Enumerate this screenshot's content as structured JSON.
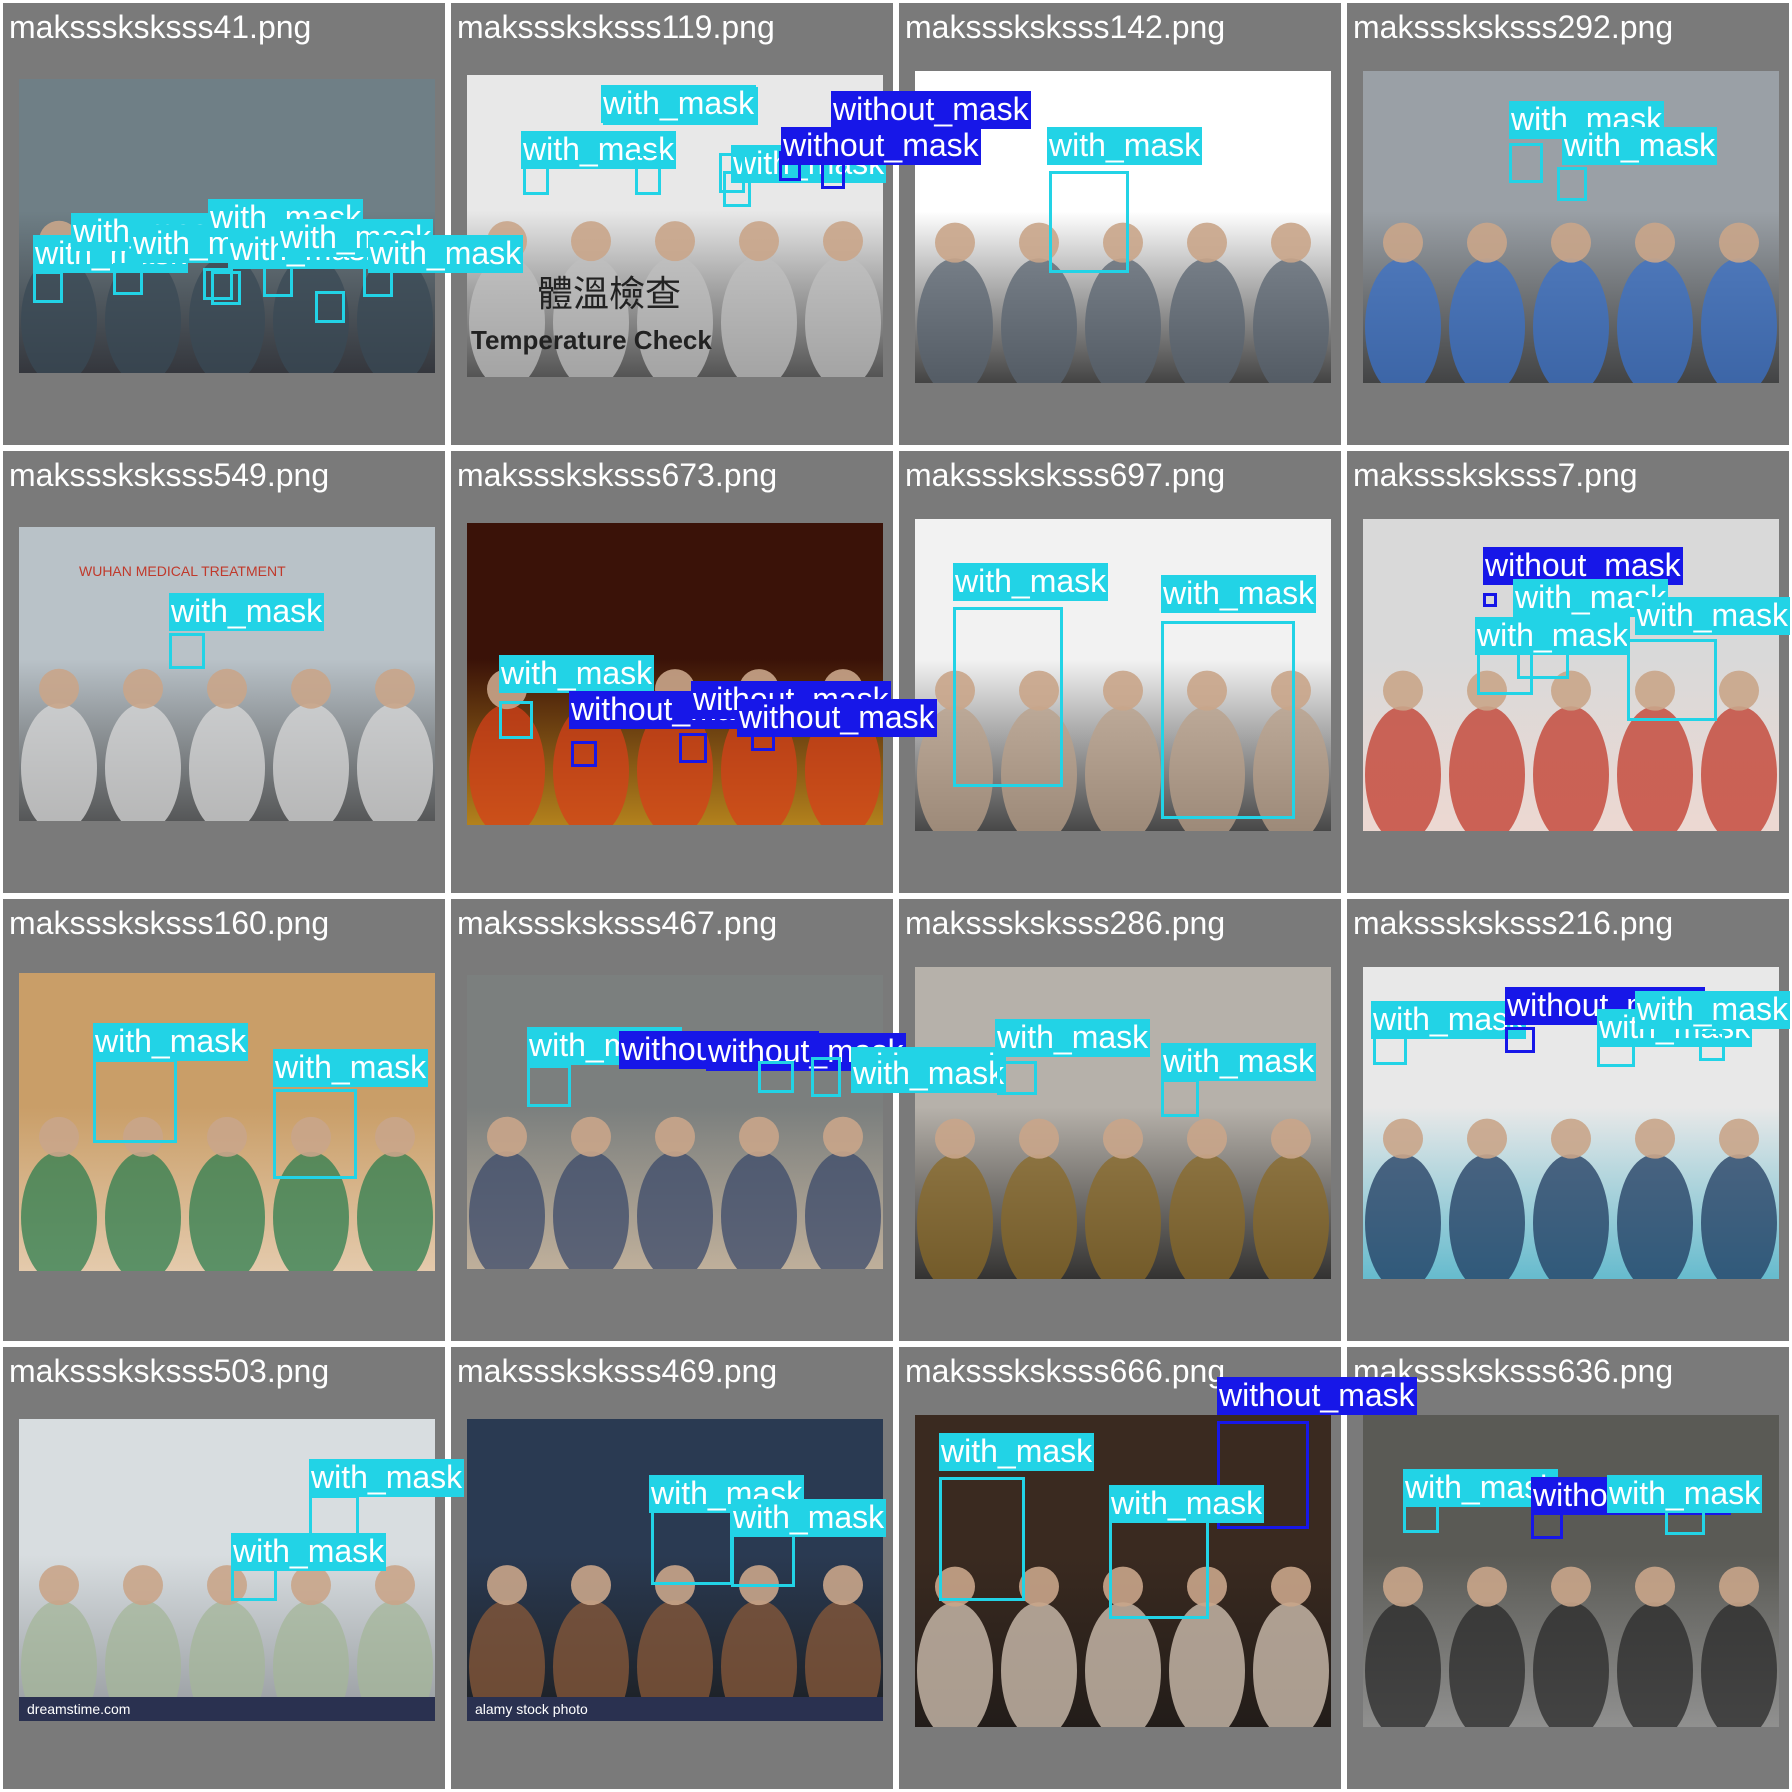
{
  "colors": {
    "tile_bg": "#7a7a7a",
    "with_mask": "#22d3e6",
    "without_mask": "#1717e8",
    "label_text": "#ffffff"
  },
  "tiles": [
    {
      "filename": "maksssksksss41.png",
      "scene": "building",
      "detections": [
        {
          "label": "with_mask"
        },
        {
          "label": "with_mask"
        },
        {
          "label": "with_mask"
        },
        {
          "label": "with_mask"
        },
        {
          "label": "with_mask"
        },
        {
          "label": "with_mask"
        },
        {
          "label": "with_mask"
        }
      ]
    },
    {
      "filename": "maksssksksss119.png",
      "scene": "temperature",
      "caption_cn": "體溫檢查",
      "caption_en": "Temperature Check",
      "detections": [
        {
          "label": "with_mask"
        },
        {
          "label": "with_mask"
        },
        {
          "label": "with_mask"
        },
        {
          "label": "with_mask"
        },
        {
          "label": "without_mask"
        },
        {
          "label": "without_mask"
        }
      ]
    },
    {
      "filename": "maksssksksss142.png",
      "scene": "businessman",
      "detections": [
        {
          "label": "with_mask"
        }
      ]
    },
    {
      "filename": "maksssksksss292.png",
      "scene": "street_emoji",
      "detections": [
        {
          "label": "with_mask"
        },
        {
          "label": "with_mask"
        }
      ]
    },
    {
      "filename": "maksssksksss549.png",
      "scene": "hospital",
      "sign_text": "WUHAN MEDICAL TREATMENT",
      "detections": [
        {
          "label": "with_mask"
        }
      ]
    },
    {
      "filename": "maksssksksss673.png",
      "scene": "market",
      "detections": [
        {
          "label": "with_mask"
        },
        {
          "label": "without_mask"
        },
        {
          "label": "without_mask"
        },
        {
          "label": "without_mask"
        }
      ]
    },
    {
      "filename": "maksssksksss697.png",
      "scene": "selfies",
      "detections": [
        {
          "label": "with_mask"
        },
        {
          "label": "with_mask"
        }
      ]
    },
    {
      "filename": "maksssksksss7.png",
      "scene": "train",
      "detections": [
        {
          "label": "without_mask"
        },
        {
          "label": "with_mask"
        },
        {
          "label": "with_mask"
        },
        {
          "label": "with_mask"
        }
      ]
    },
    {
      "filename": "maksssksksss160.png",
      "scene": "kids",
      "detections": [
        {
          "label": "with_mask"
        },
        {
          "label": "with_mask"
        }
      ]
    },
    {
      "filename": "maksssksksss467.png",
      "scene": "crowd",
      "detections": [
        {
          "label": "with_mask"
        },
        {
          "label": "without_mask"
        },
        {
          "label": "without_mask"
        },
        {
          "label": "with_mask"
        },
        {
          "label": "with_mask"
        }
      ]
    },
    {
      "filename": "maksssksksss286.png",
      "scene": "street_couple",
      "detections": [
        {
          "label": "with_mask"
        },
        {
          "label": "with_mask"
        }
      ]
    },
    {
      "filename": "maksssksksss216.png",
      "scene": "shop",
      "detections": [
        {
          "label": "with_mask"
        },
        {
          "label": "without_mask"
        },
        {
          "label": "with_mask"
        },
        {
          "label": "with_mask"
        }
      ]
    },
    {
      "filename": "maksssksksss503.png",
      "scene": "mother_baby",
      "watermark": "dreamstime.com",
      "detections": [
        {
          "label": "with_mask"
        },
        {
          "label": "with_mask"
        }
      ]
    },
    {
      "filename": "maksssksksss469.png",
      "scene": "motorbike",
      "watermark": "alamy stock photo",
      "detections": [
        {
          "label": "with_mask"
        },
        {
          "label": "with_mask"
        }
      ]
    },
    {
      "filename": "maksssksksss666.png",
      "scene": "night_women",
      "detections": [
        {
          "label": "with_mask"
        },
        {
          "label": "without_mask"
        },
        {
          "label": "with_mask"
        }
      ]
    },
    {
      "filename": "maksssksksss636.png",
      "scene": "rainy_street",
      "detections": [
        {
          "label": "with_mask"
        },
        {
          "label": "without_mask"
        },
        {
          "label": "with_mask"
        }
      ]
    }
  ]
}
